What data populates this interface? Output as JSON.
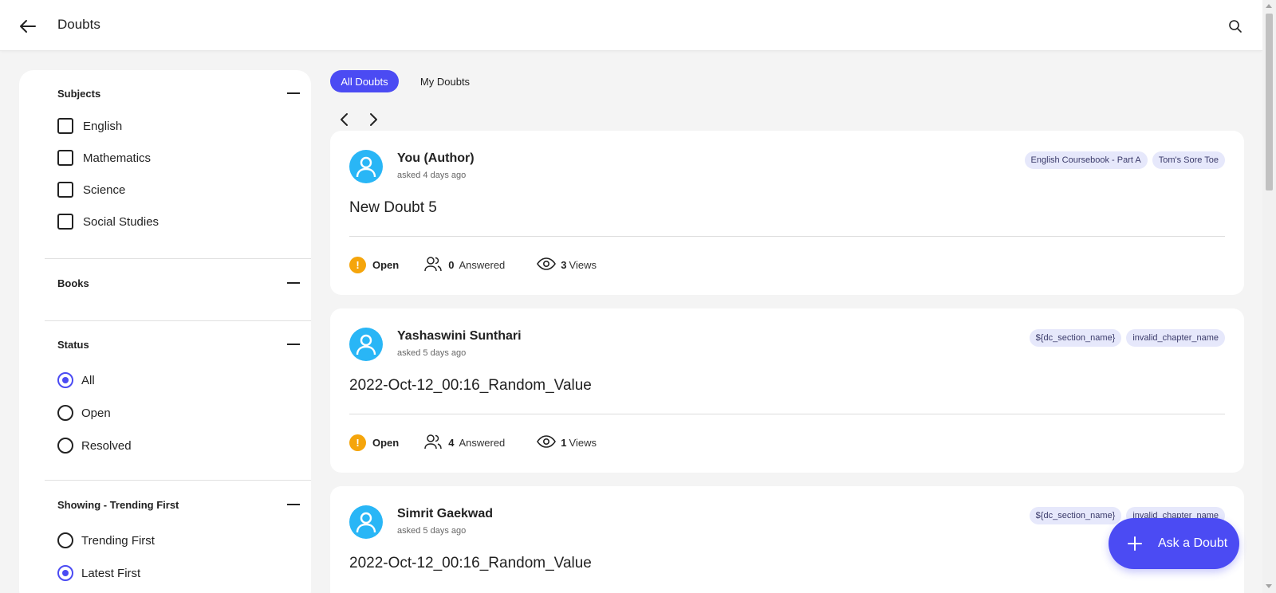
{
  "header": {
    "title": "Doubts"
  },
  "filters": {
    "subjects": {
      "title": "Subjects",
      "items": [
        "English",
        "Mathematics",
        "Science",
        "Social Studies"
      ]
    },
    "books": {
      "title": "Books"
    },
    "status": {
      "title": "Status",
      "options": [
        "All",
        "Open",
        "Resolved"
      ],
      "selected": "All"
    },
    "showing": {
      "title": "Showing - Trending First",
      "options": [
        "Trending First",
        "Latest First"
      ],
      "selected": "Latest First"
    }
  },
  "tabs": [
    {
      "label": "All Doubts",
      "active": true
    },
    {
      "label": "My Doubts",
      "active": false
    }
  ],
  "doubts": [
    {
      "author": "You (Author)",
      "asked": "asked 4 days ago",
      "tags": [
        "English Coursebook - Part A",
        "Tom's Sore Toe"
      ],
      "question": "New Doubt 5",
      "status": "Open",
      "answered_count": "0",
      "answered_label": "Answered",
      "views_count": "3",
      "views_label": "Views"
    },
    {
      "author": "Yashaswini Sunthari",
      "asked": "asked 5 days ago",
      "tags": [
        "${dc_section_name}",
        "invalid_chapter_name"
      ],
      "question": "2022-Oct-12_00:16_Random_Value",
      "status": "Open",
      "answered_count": "4",
      "answered_label": "Answered",
      "views_count": "1",
      "views_label": "Views"
    },
    {
      "author": "Simrit Gaekwad",
      "asked": "asked 5 days ago",
      "tags": [
        "${dc_section_name}",
        "invalid_chapter_name"
      ],
      "question": "2022-Oct-12_00:16_Random_Value"
    }
  ],
  "fab": {
    "label": "Ask a Doubt"
  },
  "colors": {
    "accent": "#4b4bf3",
    "open_status": "#f5a50b",
    "avatar": "#29b6f6",
    "tag_bg": "#e6e8fb"
  }
}
